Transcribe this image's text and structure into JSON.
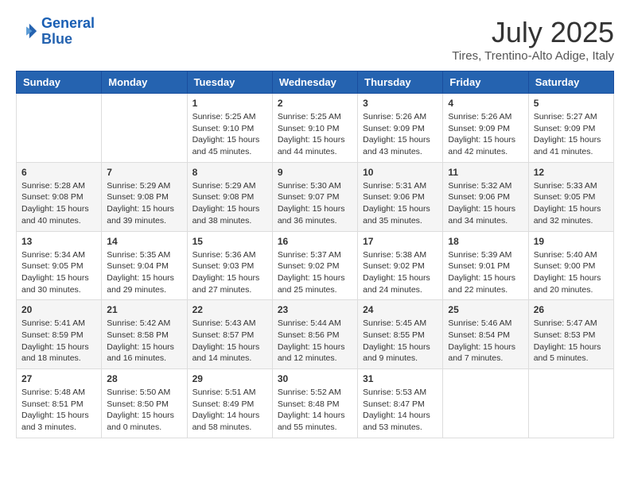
{
  "header": {
    "logo_line1": "General",
    "logo_line2": "Blue",
    "month_year": "July 2025",
    "location": "Tires, Trentino-Alto Adige, Italy"
  },
  "weekdays": [
    "Sunday",
    "Monday",
    "Tuesday",
    "Wednesday",
    "Thursday",
    "Friday",
    "Saturday"
  ],
  "weeks": [
    [
      {
        "day": "",
        "info": ""
      },
      {
        "day": "",
        "info": ""
      },
      {
        "day": "1",
        "info": "Sunrise: 5:25 AM\nSunset: 9:10 PM\nDaylight: 15 hours and 45 minutes."
      },
      {
        "day": "2",
        "info": "Sunrise: 5:25 AM\nSunset: 9:10 PM\nDaylight: 15 hours and 44 minutes."
      },
      {
        "day": "3",
        "info": "Sunrise: 5:26 AM\nSunset: 9:09 PM\nDaylight: 15 hours and 43 minutes."
      },
      {
        "day": "4",
        "info": "Sunrise: 5:26 AM\nSunset: 9:09 PM\nDaylight: 15 hours and 42 minutes."
      },
      {
        "day": "5",
        "info": "Sunrise: 5:27 AM\nSunset: 9:09 PM\nDaylight: 15 hours and 41 minutes."
      }
    ],
    [
      {
        "day": "6",
        "info": "Sunrise: 5:28 AM\nSunset: 9:08 PM\nDaylight: 15 hours and 40 minutes."
      },
      {
        "day": "7",
        "info": "Sunrise: 5:29 AM\nSunset: 9:08 PM\nDaylight: 15 hours and 39 minutes."
      },
      {
        "day": "8",
        "info": "Sunrise: 5:29 AM\nSunset: 9:08 PM\nDaylight: 15 hours and 38 minutes."
      },
      {
        "day": "9",
        "info": "Sunrise: 5:30 AM\nSunset: 9:07 PM\nDaylight: 15 hours and 36 minutes."
      },
      {
        "day": "10",
        "info": "Sunrise: 5:31 AM\nSunset: 9:06 PM\nDaylight: 15 hours and 35 minutes."
      },
      {
        "day": "11",
        "info": "Sunrise: 5:32 AM\nSunset: 9:06 PM\nDaylight: 15 hours and 34 minutes."
      },
      {
        "day": "12",
        "info": "Sunrise: 5:33 AM\nSunset: 9:05 PM\nDaylight: 15 hours and 32 minutes."
      }
    ],
    [
      {
        "day": "13",
        "info": "Sunrise: 5:34 AM\nSunset: 9:05 PM\nDaylight: 15 hours and 30 minutes."
      },
      {
        "day": "14",
        "info": "Sunrise: 5:35 AM\nSunset: 9:04 PM\nDaylight: 15 hours and 29 minutes."
      },
      {
        "day": "15",
        "info": "Sunrise: 5:36 AM\nSunset: 9:03 PM\nDaylight: 15 hours and 27 minutes."
      },
      {
        "day": "16",
        "info": "Sunrise: 5:37 AM\nSunset: 9:02 PM\nDaylight: 15 hours and 25 minutes."
      },
      {
        "day": "17",
        "info": "Sunrise: 5:38 AM\nSunset: 9:02 PM\nDaylight: 15 hours and 24 minutes."
      },
      {
        "day": "18",
        "info": "Sunrise: 5:39 AM\nSunset: 9:01 PM\nDaylight: 15 hours and 22 minutes."
      },
      {
        "day": "19",
        "info": "Sunrise: 5:40 AM\nSunset: 9:00 PM\nDaylight: 15 hours and 20 minutes."
      }
    ],
    [
      {
        "day": "20",
        "info": "Sunrise: 5:41 AM\nSunset: 8:59 PM\nDaylight: 15 hours and 18 minutes."
      },
      {
        "day": "21",
        "info": "Sunrise: 5:42 AM\nSunset: 8:58 PM\nDaylight: 15 hours and 16 minutes."
      },
      {
        "day": "22",
        "info": "Sunrise: 5:43 AM\nSunset: 8:57 PM\nDaylight: 15 hours and 14 minutes."
      },
      {
        "day": "23",
        "info": "Sunrise: 5:44 AM\nSunset: 8:56 PM\nDaylight: 15 hours and 12 minutes."
      },
      {
        "day": "24",
        "info": "Sunrise: 5:45 AM\nSunset: 8:55 PM\nDaylight: 15 hours and 9 minutes."
      },
      {
        "day": "25",
        "info": "Sunrise: 5:46 AM\nSunset: 8:54 PM\nDaylight: 15 hours and 7 minutes."
      },
      {
        "day": "26",
        "info": "Sunrise: 5:47 AM\nSunset: 8:53 PM\nDaylight: 15 hours and 5 minutes."
      }
    ],
    [
      {
        "day": "27",
        "info": "Sunrise: 5:48 AM\nSunset: 8:51 PM\nDaylight: 15 hours and 3 minutes."
      },
      {
        "day": "28",
        "info": "Sunrise: 5:50 AM\nSunset: 8:50 PM\nDaylight: 15 hours and 0 minutes."
      },
      {
        "day": "29",
        "info": "Sunrise: 5:51 AM\nSunset: 8:49 PM\nDaylight: 14 hours and 58 minutes."
      },
      {
        "day": "30",
        "info": "Sunrise: 5:52 AM\nSunset: 8:48 PM\nDaylight: 14 hours and 55 minutes."
      },
      {
        "day": "31",
        "info": "Sunrise: 5:53 AM\nSunset: 8:47 PM\nDaylight: 14 hours and 53 minutes."
      },
      {
        "day": "",
        "info": ""
      },
      {
        "day": "",
        "info": ""
      }
    ]
  ]
}
